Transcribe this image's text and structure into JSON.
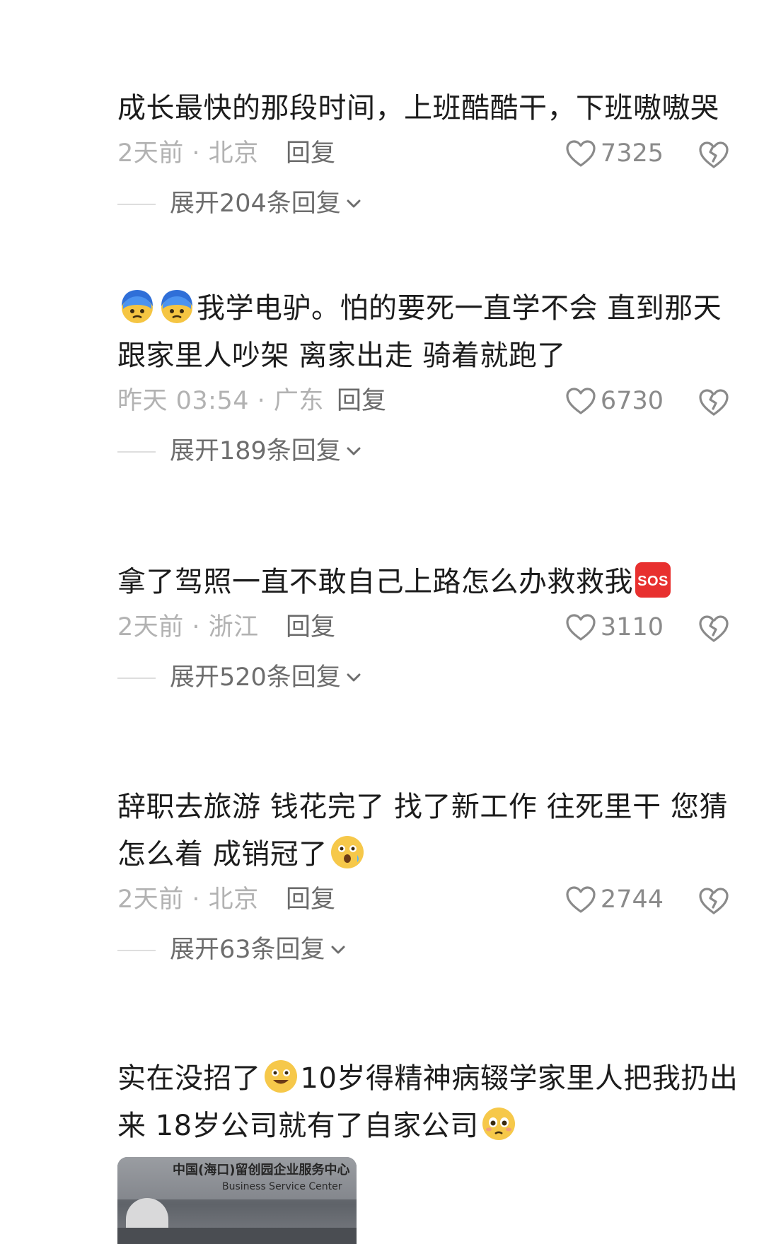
{
  "comments": [
    {
      "text_segments": [
        "成长最快的那段时间，上班酷酷干，下班嗷嗷哭"
      ],
      "time_location": "2天前 · 北京",
      "reply_label": "回复",
      "likes": "7325",
      "expand_label": "展开204条回复"
    },
    {
      "leading_emojis": [
        "anxious-blue-face-emoji",
        "anxious-blue-face-emoji"
      ],
      "text_segments": [
        "我学电驴。怕的要死一直学不会 直到那天跟家里人吵架 离家出走 骑着就跑了"
      ],
      "time_location": "昨天 03:54 · 广东",
      "reply_label": "回复",
      "likes": "6730",
      "expand_label": "展开189条回复"
    },
    {
      "text_segments": [
        "拿了驾照一直不敢自己上路怎么办救救我"
      ],
      "trailing_badge": "SOS",
      "time_location": "2天前 · 浙江",
      "reply_label": "回复",
      "likes": "3110",
      "expand_label": "展开520条回复"
    },
    {
      "text_segments": [
        "辞职去旅游 钱花完了 找了新工作 往死里干 您猜怎么着 成销冠了"
      ],
      "trailing_emoji": "surprised-face-emoji",
      "time_location": "2天前 · 北京",
      "reply_label": "回复",
      "likes": "2744",
      "expand_label": "展开63条回复"
    },
    {
      "text_segments": [
        "实在没招了",
        "10岁得精神病辍学家里人把我扔出来 18岁公司就有了自家公司"
      ],
      "inline_emojis": [
        "grinning-face-emoji",
        "pleading-face-emoji"
      ]
    }
  ],
  "thumbnail": {
    "sign_text": "中国(海口)留创园企业服务中心",
    "sign_subtext": "Business Service Center"
  },
  "colors": {
    "text": "#1c1c1c",
    "meta": "#b2b2b2",
    "reply": "#6a6a6a",
    "like": "#8a8a8a",
    "sos_badge": "#e8302f"
  }
}
